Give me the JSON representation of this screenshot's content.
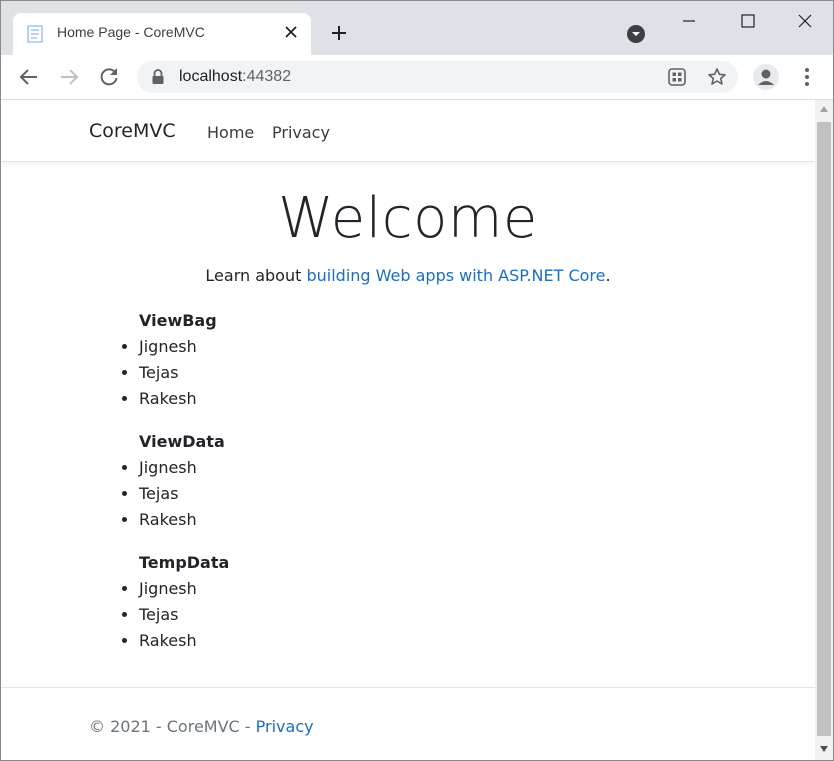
{
  "browser": {
    "tab_title": "Home Page - CoreMVC",
    "url_host": "localhost",
    "url_port": ":44382"
  },
  "site": {
    "brand": "CoreMVC",
    "nav": [
      {
        "label": "Home"
      },
      {
        "label": "Privacy"
      }
    ],
    "welcome": "Welcome",
    "lead_prefix": "Learn about ",
    "lead_link": "building Web apps with ASP.NET Core",
    "lead_suffix": ".",
    "sections": [
      {
        "title": "ViewBag",
        "items": [
          "Jignesh",
          "Tejas",
          "Rakesh"
        ]
      },
      {
        "title": "ViewData",
        "items": [
          "Jignesh",
          "Tejas",
          "Rakesh"
        ]
      },
      {
        "title": "TempData",
        "items": [
          "Jignesh",
          "Tejas",
          "Rakesh"
        ]
      }
    ],
    "footer_text": "© 2021 - CoreMVC - ",
    "footer_link": "Privacy"
  },
  "colors": {
    "link": "#1b6ec2",
    "tabstrip": "#dee1e6",
    "omnibox": "#f1f3f4"
  }
}
